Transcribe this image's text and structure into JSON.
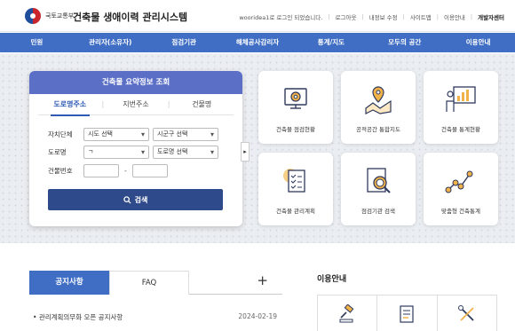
{
  "header": {
    "ministry": "국토교통부",
    "system_title": "건축물 생애이력 관리시스템",
    "user_notice": "wooridea1로 로그인 되었습니다.",
    "util_links": [
      "로그아웃",
      "내정보 수정",
      "사이트맵",
      "이용안내"
    ],
    "dev_center": "개발자센터"
  },
  "nav": {
    "items": [
      "민원",
      "관리자(소유자)",
      "점검기관",
      "해체공사감리자",
      "통계/지도",
      "모두의 공간",
      "이용안내"
    ]
  },
  "search_card": {
    "title": "건축물 요약정보 조회",
    "tabs": [
      "도로명주소",
      "지번주소",
      "건물명"
    ],
    "active_tab": "도로명주소",
    "region_label": "자치단체",
    "sido_select": "시도 선택",
    "sigungu_select": "시군구 선택",
    "road_label": "도로명",
    "initial_select": "ㄱ",
    "road_select": "도로명 선택",
    "building_no_label": "건물번호",
    "building_no_separator": "-",
    "search_button": "검색"
  },
  "tiles": [
    {
      "label": "건축물 점검현황",
      "icon": "inspection-monitor-icon"
    },
    {
      "label": "공적공간 통합지도",
      "icon": "map-pin-icon"
    },
    {
      "label": "건축물 통계현황",
      "icon": "statistics-board-icon"
    },
    {
      "label": "건축물 관리계획",
      "icon": "checklist-icon"
    },
    {
      "label": "점검기관 검색",
      "icon": "document-search-icon"
    },
    {
      "label": "맞춤형 건축통계",
      "icon": "line-chart-icon"
    }
  ],
  "board": {
    "tabs": [
      "공지사항",
      "FAQ"
    ],
    "more": "+",
    "notice": {
      "title": "관리계획의무화 오픈 공지사항",
      "date": "2024-02-19"
    }
  },
  "guide": {
    "title": "이용안내",
    "icons": [
      "gavel-icon",
      "document-icon",
      "tools-icon"
    ]
  },
  "colors": {
    "nav": "#3f6ec4",
    "card_head": "#5b6fc7",
    "search_button": "#2f4a8a",
    "icon_accent": "#f2b24a",
    "icon_line": "#2f3a5c"
  }
}
